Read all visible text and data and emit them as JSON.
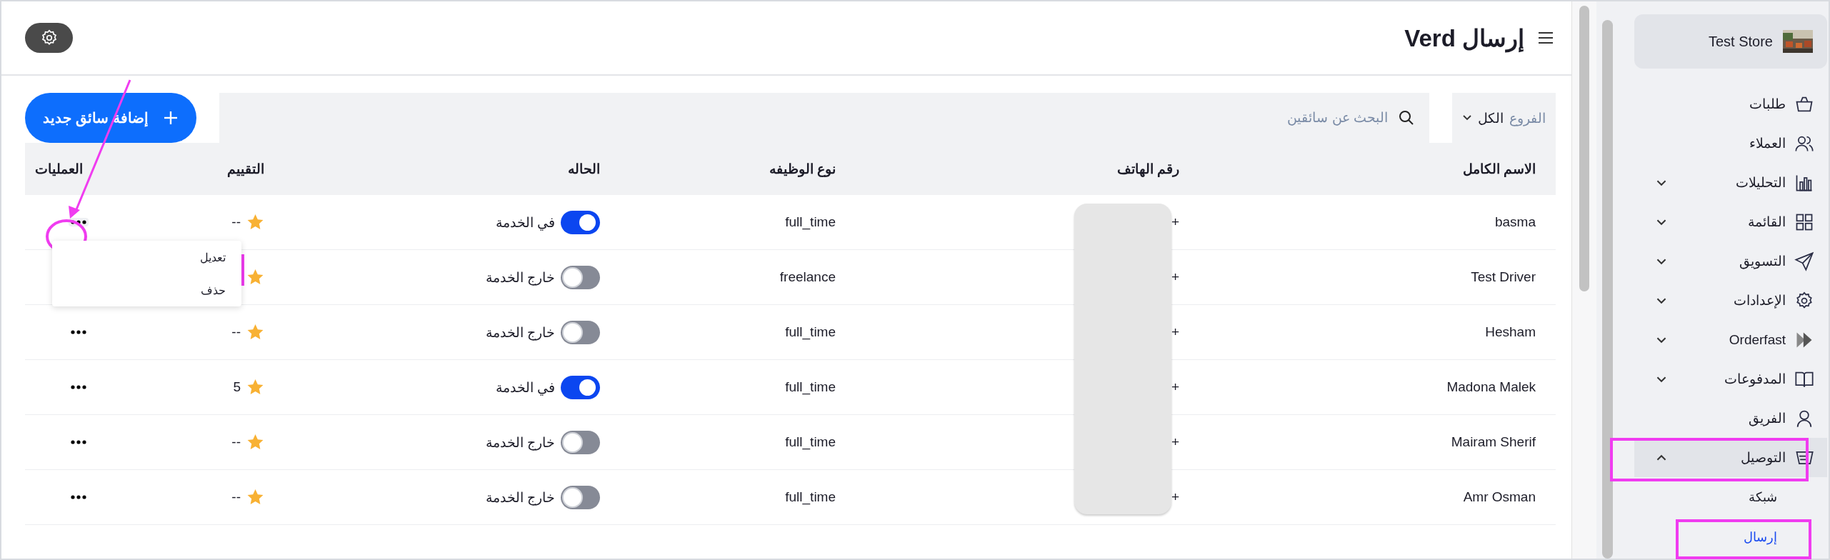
{
  "header": {
    "title": "إرسال Verd"
  },
  "toolbar": {
    "branch_filter": {
      "label": "الفروع",
      "value": "الكل"
    },
    "search": {
      "placeholder": "البحث عن سائقين"
    },
    "add_button": "إضافة سائق جديد"
  },
  "table": {
    "columns": [
      "الاسم الكامل",
      "رقم الهاتف",
      "نوع الوظيفه",
      "الحاله",
      "التقييم",
      "العمليات"
    ],
    "rows": [
      {
        "name": "basma",
        "phone": "+",
        "job_type": "full_time",
        "status": {
          "on": true,
          "label": "في الخدمة"
        },
        "rating": "--",
        "menu_open": true
      },
      {
        "name": "Test Driver",
        "phone": "+",
        "job_type": "freelance",
        "status": {
          "on": false,
          "label": "خارج الخدمة"
        },
        "rating": "",
        "menu_open": false
      },
      {
        "name": "Hesham",
        "phone": "+",
        "job_type": "full_time",
        "status": {
          "on": false,
          "label": "خارج الخدمة"
        },
        "rating": "--",
        "menu_open": false
      },
      {
        "name": "Madona Malek",
        "phone": "+",
        "job_type": "full_time",
        "status": {
          "on": true,
          "label": "في الخدمة"
        },
        "rating": "5",
        "menu_open": false
      },
      {
        "name": "Mairam Sherif",
        "phone": "+",
        "job_type": "full_time",
        "status": {
          "on": false,
          "label": "خارج الخدمة"
        },
        "rating": "--",
        "menu_open": false
      },
      {
        "name": "Amr Osman",
        "phone": "+",
        "job_type": "full_time",
        "status": {
          "on": false,
          "label": "خارج الخدمة"
        },
        "rating": "--",
        "menu_open": false
      }
    ],
    "row_menu": {
      "items": [
        "تعديل",
        "حذف"
      ]
    }
  },
  "sidebar": {
    "store": "Test Store",
    "items": [
      {
        "label": "طلبات",
        "expandable": false,
        "expanded": false,
        "selected": false
      },
      {
        "label": "العملاء",
        "expandable": false,
        "expanded": false,
        "selected": false
      },
      {
        "label": "التحليلات",
        "expandable": true,
        "expanded": false,
        "selected": false
      },
      {
        "label": "القائمة",
        "expandable": true,
        "expanded": false,
        "selected": false
      },
      {
        "label": "التسويق",
        "expandable": true,
        "expanded": false,
        "selected": false
      },
      {
        "label": "الإعدادات",
        "expandable": true,
        "expanded": false,
        "selected": false
      },
      {
        "label": "Orderfast",
        "expandable": true,
        "expanded": false,
        "selected": false
      },
      {
        "label": "المدفوعات",
        "expandable": true,
        "expanded": false,
        "selected": false
      },
      {
        "label": "الفريق",
        "expandable": false,
        "expanded": false,
        "selected": false
      },
      {
        "label": "التوصيل",
        "expandable": true,
        "expanded": true,
        "selected": true,
        "children": [
          {
            "label": "شبكة",
            "selected": false
          },
          {
            "label": "إرسال",
            "selected": true
          }
        ]
      }
    ]
  }
}
